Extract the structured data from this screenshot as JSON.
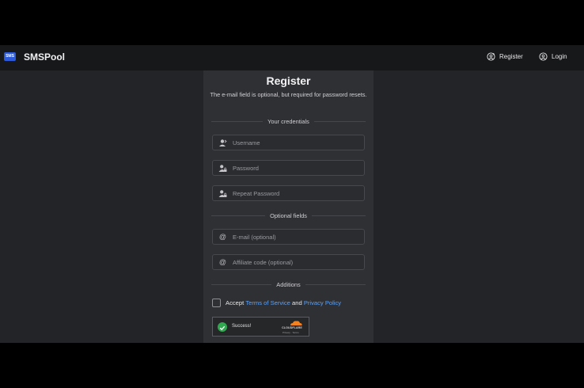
{
  "header": {
    "logo_text": "SMS",
    "brand": "SMSPool",
    "register_label": "Register",
    "login_label": "Login"
  },
  "form": {
    "title": "Register",
    "subtitle": "The e-mail field is optional, but required for password resets.",
    "section_credentials": "Your credentials",
    "username_placeholder": "Username",
    "password_placeholder": "Password",
    "repeat_password_placeholder": "Repeat Password",
    "section_optional": "Optional fields",
    "email_placeholder": "E-mail (optional)",
    "affiliate_placeholder": "Affiliate code (optional)",
    "section_additions": "Additions",
    "accept_prefix": "Accept",
    "terms_link": "Terms of Service",
    "and_text": "and",
    "privacy_link": "Privacy Policy",
    "terms_accepted": false
  },
  "captcha": {
    "status": "Success!",
    "provider": "CLOUDFLARE",
    "privacy_label": "Privacy",
    "separator": "·",
    "terms_label": "Terms"
  },
  "icons": {
    "register": "user-plus-icon",
    "login": "user-circle-icon",
    "username": "user-icon",
    "password": "user-lock-icon",
    "repeat_password": "user-lock-icon",
    "email": "at-icon",
    "affiliate": "at-icon",
    "captcha_ok": "check-circle-icon"
  },
  "colors": {
    "accent_link": "#5da0f2",
    "logo_bg": "#2c5ad8",
    "success": "#2fa84f",
    "cloudflare": "#f48120"
  }
}
